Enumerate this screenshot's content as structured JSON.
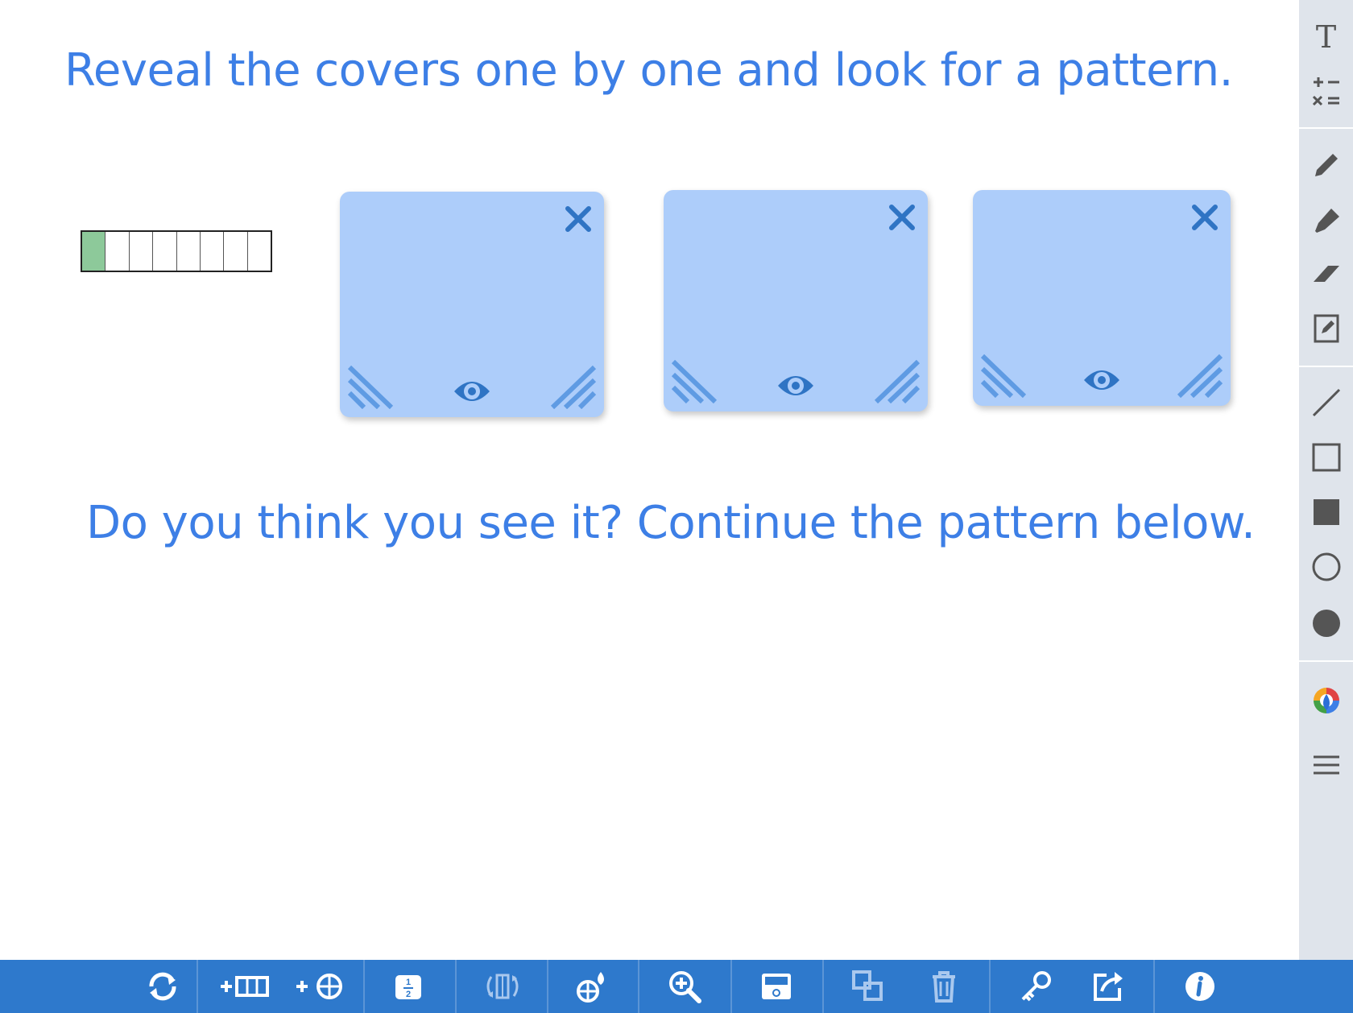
{
  "canvas": {
    "heading_top": "Reveal the covers one by one and look for a pattern.",
    "heading_bottom": "Do you think you see it? Continue the pattern below.",
    "fraction_bar": {
      "total_cells": 8,
      "filled_cells": 1,
      "fill_color": "#8dc99a"
    },
    "covers": [
      {
        "icons": [
          "close-icon",
          "eye-icon",
          "resize-left-icon",
          "resize-right-icon"
        ]
      },
      {
        "icons": [
          "close-icon",
          "eye-icon",
          "resize-left-icon",
          "resize-right-icon"
        ]
      },
      {
        "icons": [
          "close-icon",
          "eye-icon",
          "resize-left-icon",
          "resize-right-icon"
        ]
      }
    ]
  },
  "right_toolbar": {
    "text_tool_label": "T",
    "tools": [
      "text-tool",
      "math-text-tool",
      "pen-tool",
      "highlighter-tool",
      "eraser-tool",
      "note-tool",
      "line-tool",
      "rectangle-outline-tool",
      "rectangle-filled-tool",
      "circle-outline-tool",
      "circle-filled-tool",
      "color-picker-tool",
      "menu-tool"
    ]
  },
  "bottom_toolbar": {
    "tools": [
      "reset",
      "add-bar",
      "add-circle",
      "fraction-label",
      "flip",
      "fill-color",
      "zoom",
      "cover",
      "duplicate",
      "delete",
      "key",
      "share",
      "info"
    ]
  },
  "colors": {
    "heading": "#3d7fe6",
    "cover": "#adcdfa",
    "cover_icon": "#2f74c4",
    "toolbar_bottom": "#2e79cc",
    "toolbar_right": "#dfe4eb"
  }
}
